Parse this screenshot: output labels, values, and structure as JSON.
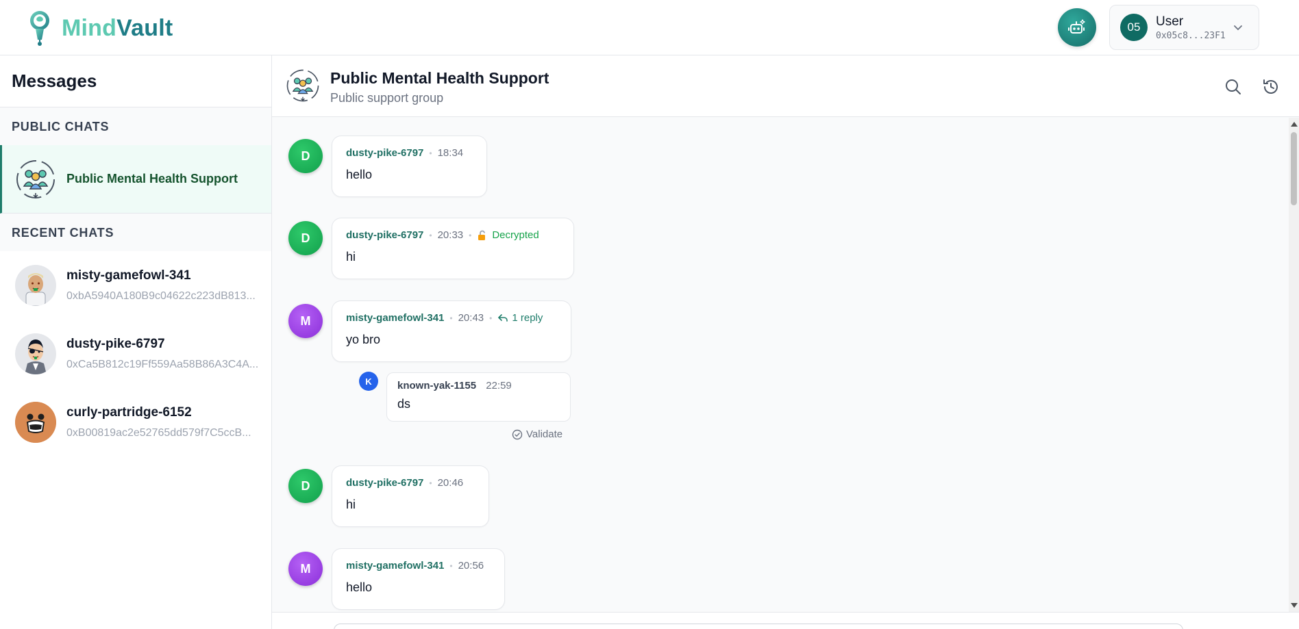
{
  "brand": {
    "part1": "Mind",
    "part2": "Vault"
  },
  "user": {
    "initials": "05",
    "name": "User",
    "address": "0x05c8...23F1"
  },
  "sidebar": {
    "title": "Messages",
    "public_section": "PUBLIC CHATS",
    "public_chats": [
      {
        "name": "Public Mental Health Support"
      }
    ],
    "recent_section": "RECENT CHATS",
    "recent_chats": [
      {
        "name": "misty-gamefowl-341",
        "address": "0xbA5940A180B9c04622c223dB813..."
      },
      {
        "name": "dusty-pike-6797",
        "address": "0xCa5B812c19Ff559Aa58B86A3C4A..."
      },
      {
        "name": "curly-partridge-6152",
        "address": "0xB00819ac2e52765dd579f7C5ccB..."
      }
    ]
  },
  "chat": {
    "title": "Public Mental Health Support",
    "subtitle": "Public support group"
  },
  "messages": [
    {
      "initial": "D",
      "author": "dusty-pike-6797",
      "time": "18:34",
      "text": "hello"
    },
    {
      "initial": "D",
      "author": "dusty-pike-6797",
      "time": "20:33",
      "badge": "Decrypted",
      "text": "hi"
    },
    {
      "initial": "M",
      "author": "misty-gamefowl-341",
      "time": "20:43",
      "replies_label": "1 reply",
      "text": "yo bro",
      "reply": {
        "initial": "K",
        "author": "known-yak-1155",
        "time": "22:59",
        "text": "ds"
      },
      "validate_label": "Validate"
    },
    {
      "initial": "D",
      "author": "dusty-pike-6797",
      "time": "20:46",
      "text": "hi"
    },
    {
      "initial": "M",
      "author": "misty-gamefowl-341",
      "time": "20:56",
      "text": "hello"
    }
  ],
  "icons": {
    "logo": "keyhole-brain-icon",
    "ai": "robot-sparkle-icon",
    "chevron": "chevron-down-icon",
    "search": "search-icon",
    "history": "history-icon",
    "lock": "unlocked-padlock-icon",
    "reply": "reply-arrow-icon",
    "validate": "check-circle-icon",
    "group": "community-group-icon"
  },
  "colors": {
    "brand_light": "#5dc9b1",
    "brand_dark": "#1f7d87",
    "accent": "#1f7d6b",
    "active_bg": "#effbf7",
    "avatar_green": "#16a34a",
    "avatar_purple": "#9333ea",
    "avatar_blue": "#2563eb",
    "decrypted": "#16a34a"
  }
}
